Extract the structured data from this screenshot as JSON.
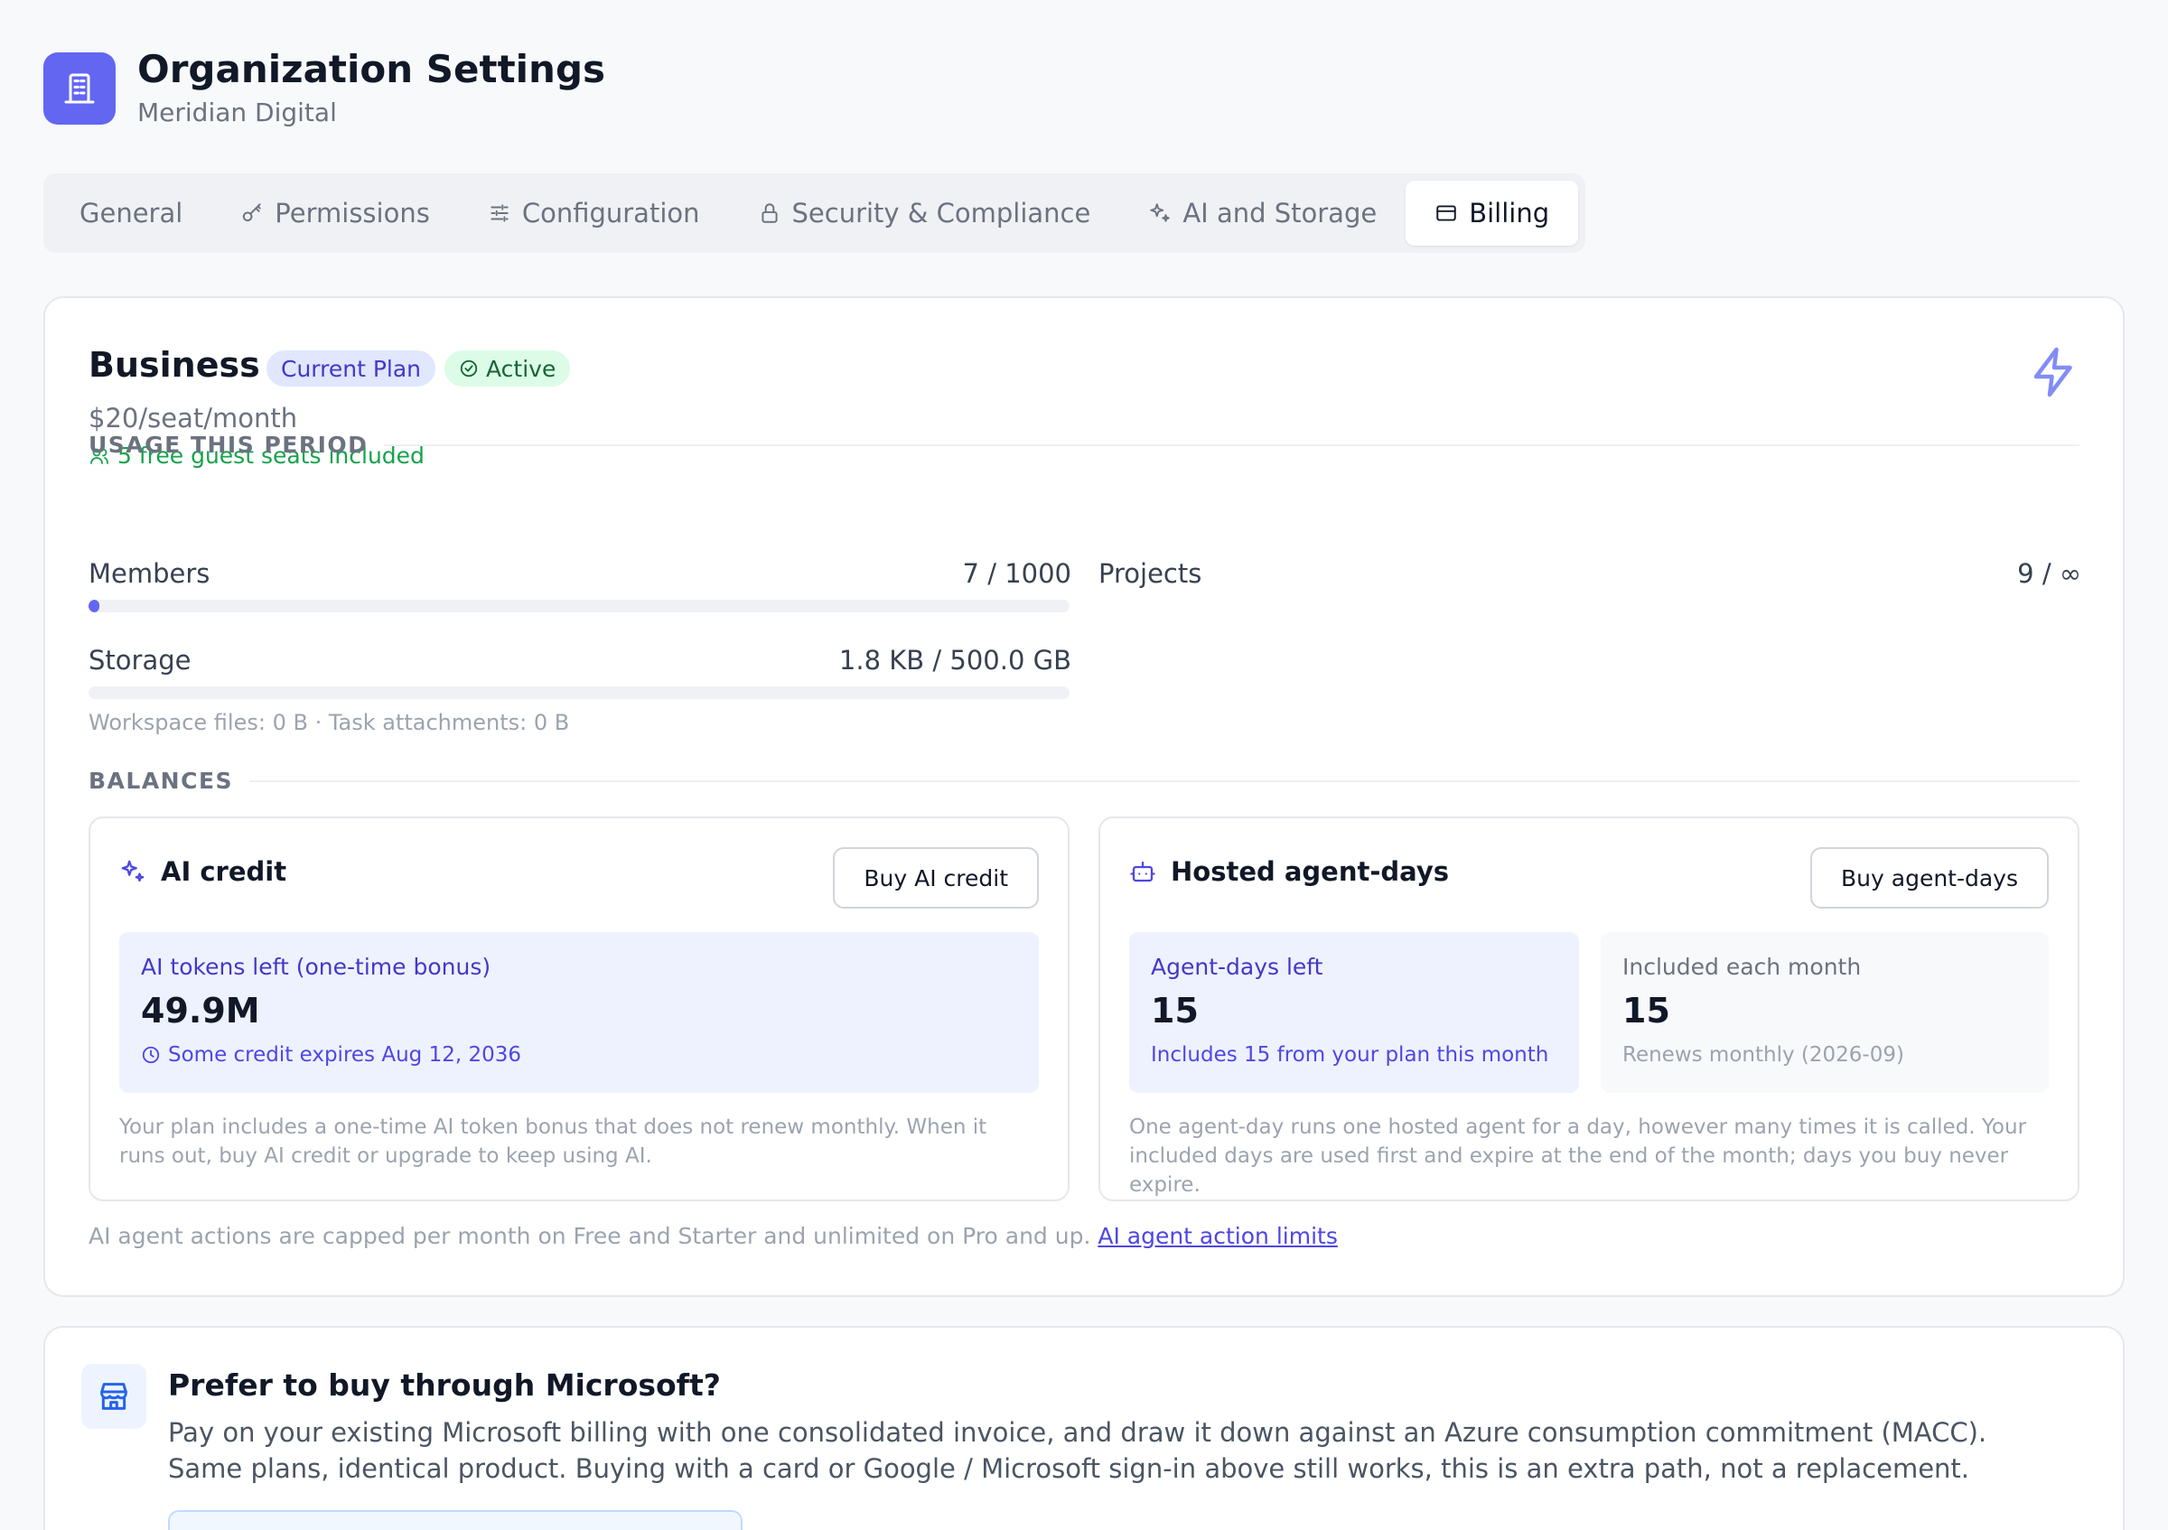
{
  "header": {
    "title": "Organization Settings",
    "org_name": "Meridian Digital"
  },
  "tabs": [
    {
      "label": "General",
      "icon": "none"
    },
    {
      "label": "Permissions",
      "icon": "key-icon"
    },
    {
      "label": "Configuration",
      "icon": "sliders-icon"
    },
    {
      "label": "Security & Compliance",
      "icon": "lock-icon"
    },
    {
      "label": "AI and Storage",
      "icon": "sparkles-icon"
    },
    {
      "label": "Billing",
      "icon": "credit-card-icon",
      "active": true
    }
  ],
  "plan": {
    "name": "Business",
    "badge_plan": "Current Plan",
    "badge_status": "Active",
    "price": "$20/seat/month",
    "guest_seats": "5 free guest seats included"
  },
  "usage": {
    "title": "USAGE THIS PERIOD",
    "members": {
      "label": "Members",
      "value": "7 / 1000",
      "fraction": 0.007
    },
    "projects": {
      "label": "Projects",
      "value": "9 / ∞"
    },
    "storage": {
      "label": "Storage",
      "value": "1.8 KB / 500.0 GB",
      "fraction": 0
    },
    "files_note": "Workspace files: 0 B · Task attachments: 0 B"
  },
  "balances": {
    "title": "BALANCES",
    "ai_credit": {
      "title": "AI credit",
      "button": "Buy AI credit",
      "stat_label": "AI tokens left (one-time bonus)",
      "stat_value": "49.9M",
      "stat_sub": "Some credit expires Aug 12, 2036",
      "description": "Your plan includes a one-time AI token bonus that does not renew monthly. When it runs out, buy AI credit or upgrade to keep using AI."
    },
    "agent_days": {
      "title": "Hosted agent-days",
      "button": "Buy agent-days",
      "left_label": "Agent-days left",
      "left_value": "15",
      "left_sub": "Includes 15 from your plan this month",
      "included_label": "Included each month",
      "included_value": "15",
      "included_sub": "Renews monthly (2026-09)",
      "description": "One agent-day runs one hosted agent for a day, however many times it is called. Your included days are used first and expire at the end of the month; days you buy never expire."
    }
  },
  "agent_note": {
    "text": "AI agent actions are capped per month on Free and Starter and unlimited on Pro and up.",
    "link": "AI agent action limits"
  },
  "microsoft": {
    "title": "Prefer to buy through Microsoft?",
    "description": "Pay on your existing Microsoft billing with one consolidated invoice, and draw it down against an Azure consumption commitment (MACC). Same plans, identical product. Buying with a card or Google / Microsoft sign-in above still works, this is an extra path, not a replacement."
  },
  "colors": {
    "accent": "#6366f1",
    "success": "#16a34a",
    "muted": "#6b7280"
  }
}
